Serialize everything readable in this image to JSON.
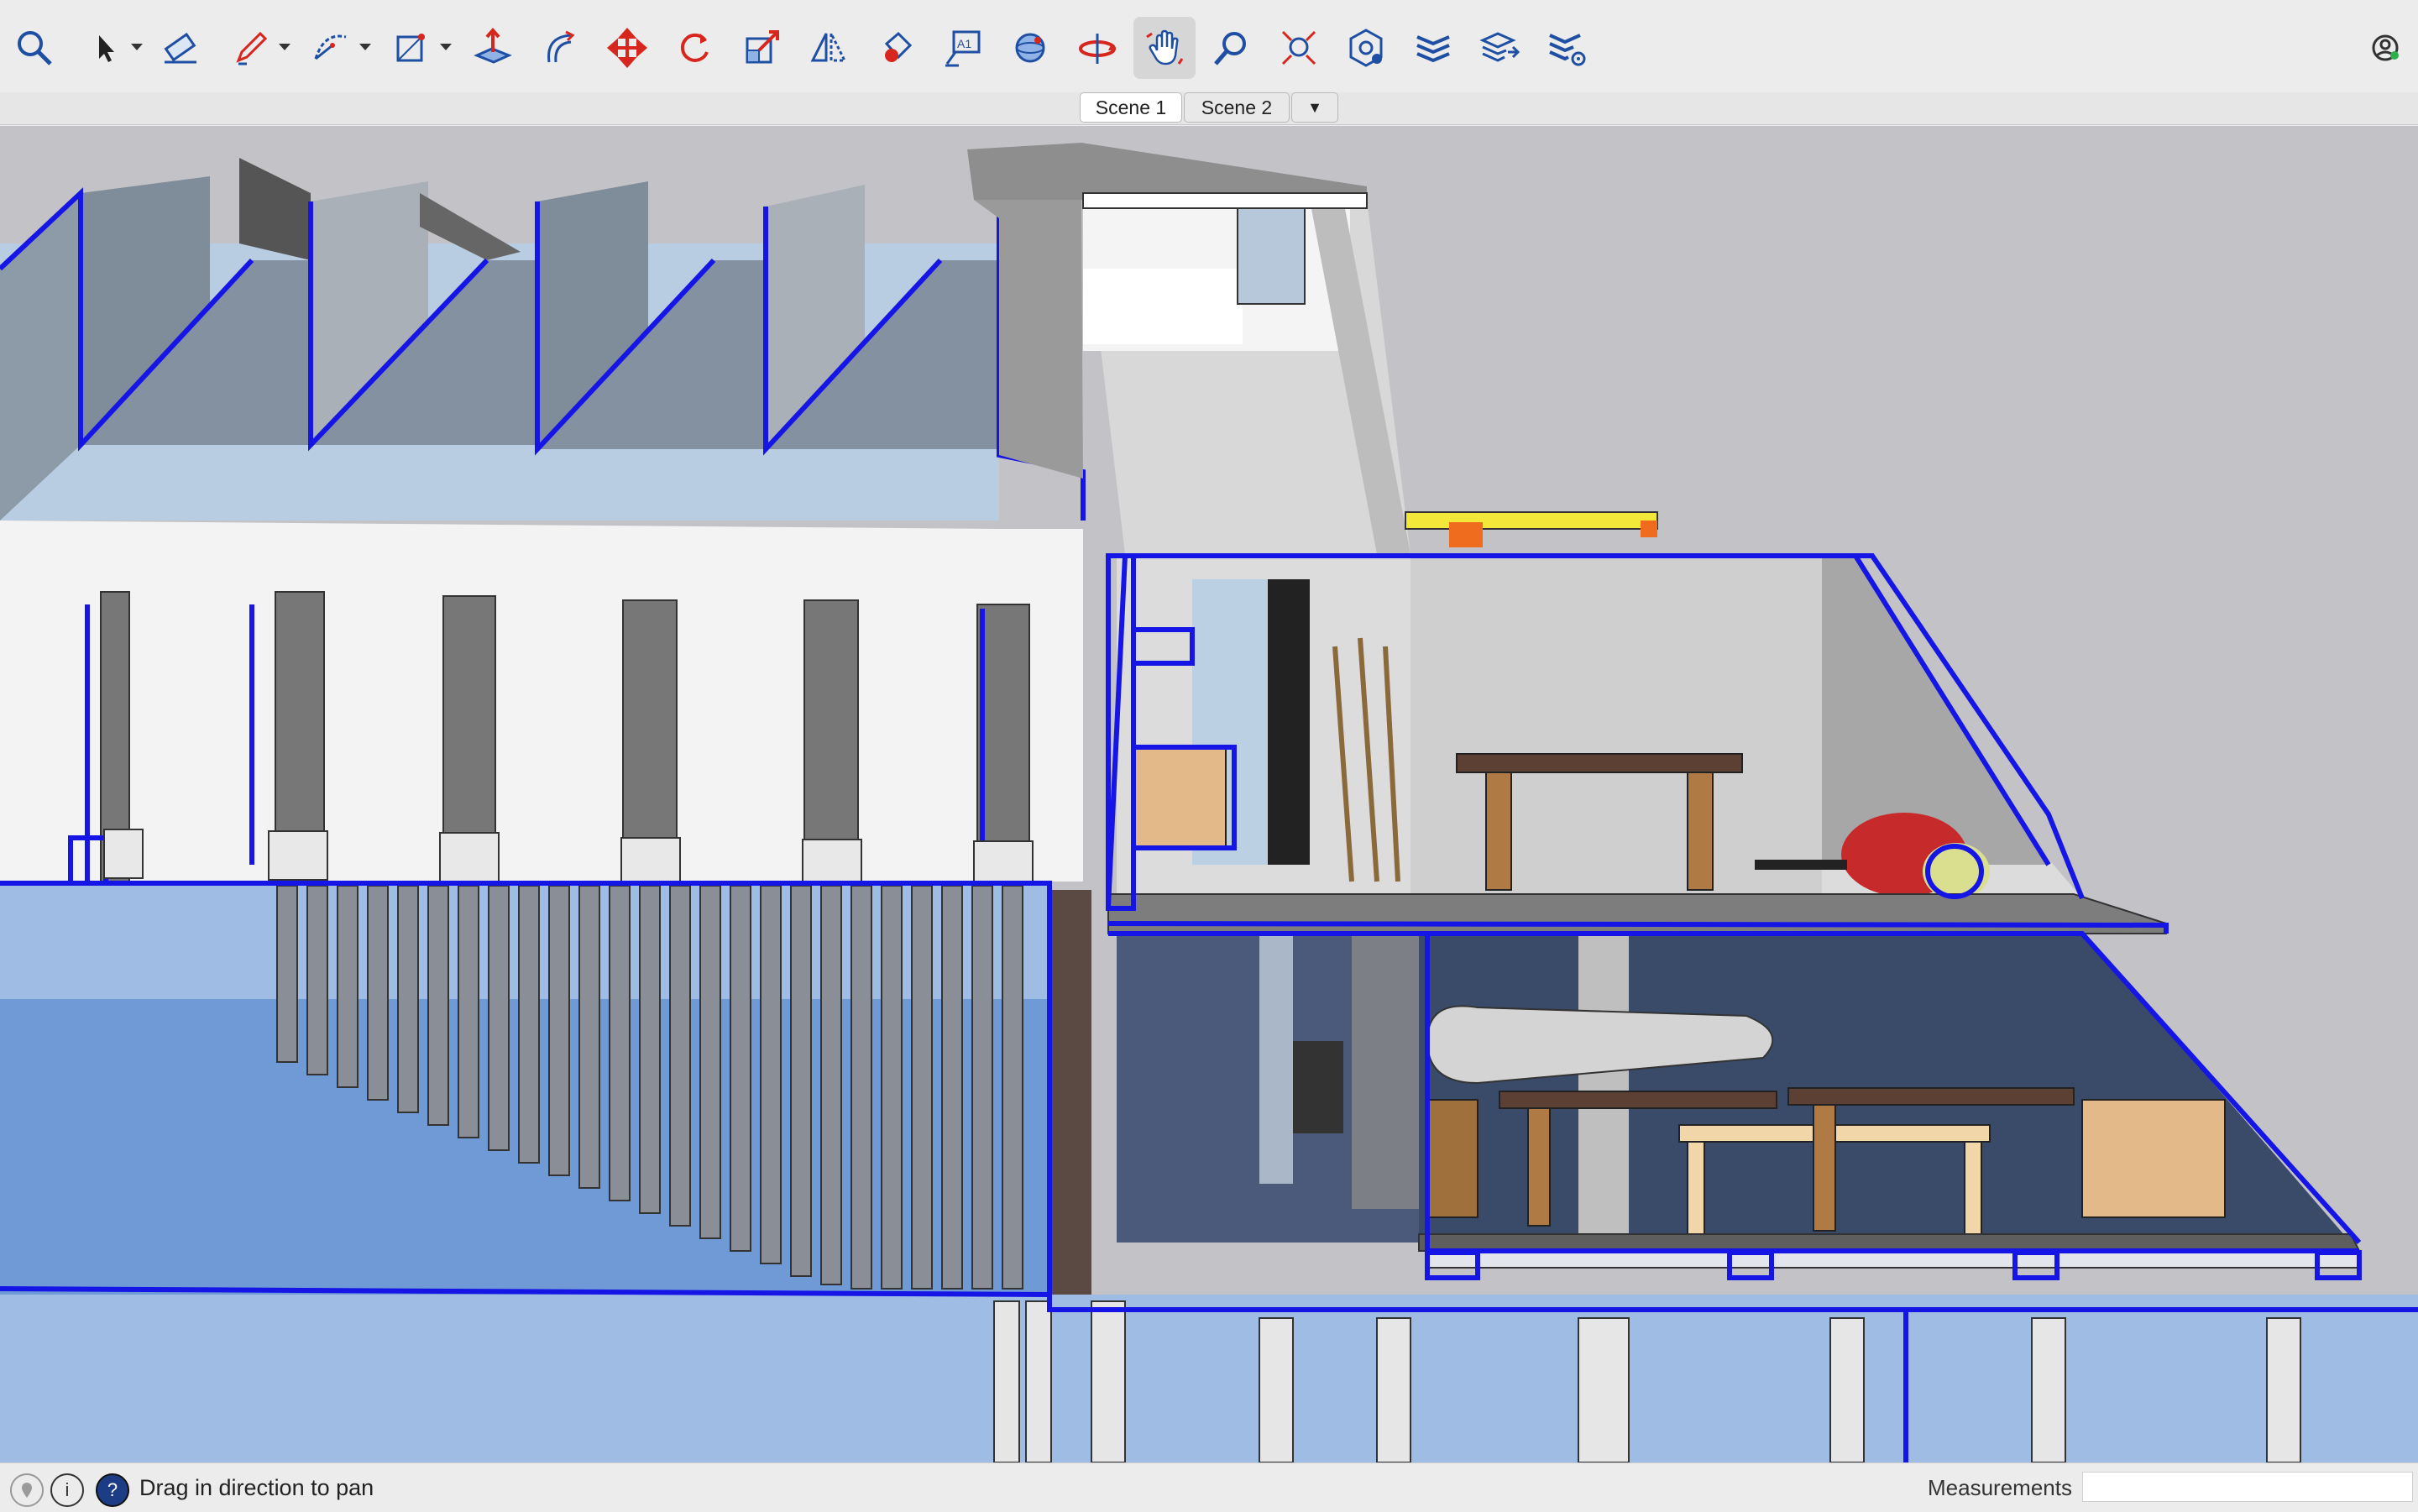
{
  "toolbar": {
    "tools": [
      {
        "name": "search-icon",
        "label": "Search"
      },
      {
        "name": "select-icon",
        "label": "Select"
      },
      {
        "name": "eraser-icon",
        "label": "Eraser"
      },
      {
        "name": "pencil-icon",
        "label": "Line"
      },
      {
        "name": "arc-icon",
        "label": "Arc"
      },
      {
        "name": "rectangle-icon",
        "label": "Rectangle"
      },
      {
        "name": "push-pull-icon",
        "label": "Push/Pull"
      },
      {
        "name": "offset-icon",
        "label": "Offset"
      },
      {
        "name": "move-icon",
        "label": "Move"
      },
      {
        "name": "rotate-icon",
        "label": "Rotate"
      },
      {
        "name": "scale-icon",
        "label": "Scale"
      },
      {
        "name": "flip-icon",
        "label": "Flip"
      },
      {
        "name": "paint-icon",
        "label": "Paint Bucket"
      },
      {
        "name": "text-icon",
        "label": "Text"
      },
      {
        "name": "sphere-icon",
        "label": "Orbit"
      },
      {
        "name": "orbit-icon",
        "label": "Orbit"
      },
      {
        "name": "pan-hand-icon",
        "label": "Pan"
      },
      {
        "name": "zoom-icon",
        "label": "Zoom"
      },
      {
        "name": "zoom-extents-icon",
        "label": "Zoom Extents"
      },
      {
        "name": "section-plane-icon",
        "label": "Section Plane"
      },
      {
        "name": "layers-icon",
        "label": "Tags"
      },
      {
        "name": "layers-export-icon",
        "label": "Layers"
      },
      {
        "name": "layers-settings-icon",
        "label": "Layer Settings"
      }
    ],
    "active_tool": "pan-hand-icon",
    "accent": "#1f4fa3",
    "red": "#d7261e"
  },
  "scenes": {
    "tabs": [
      "Scene 1",
      "Scene 2"
    ],
    "active": "Scene 1",
    "menu_glyph": "▼"
  },
  "status": {
    "message": "Drag in direction to pan",
    "help_glyph": "?",
    "info_glyph": "i",
    "measurements_label": "Measurements",
    "measurements_value": ""
  },
  "colors": {
    "section_outline": "#1515e6",
    "water": "#6f9ad6",
    "sky": "#c3c3c7",
    "wall": "#f1f1f1"
  }
}
